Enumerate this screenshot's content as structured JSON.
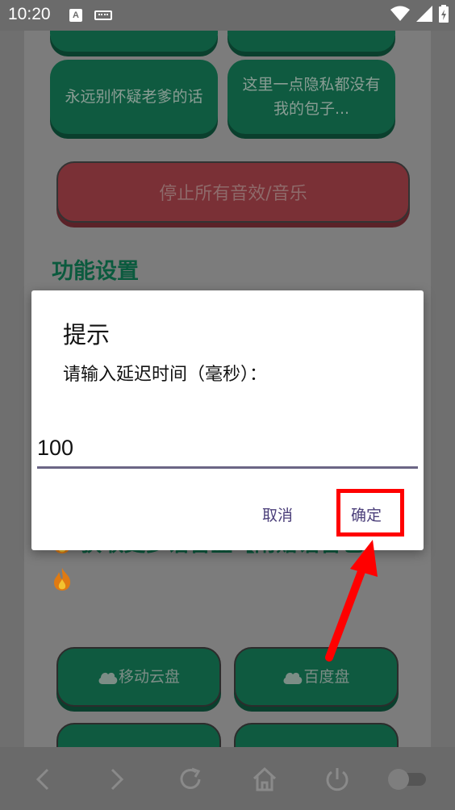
{
  "status_bar": {
    "time": "10:20",
    "a_icon": "A",
    "icons": [
      "wifi-icon",
      "signal-icon",
      "battery-icon"
    ]
  },
  "app": {
    "top_buttons": [
      "",
      ""
    ],
    "buttons_row": [
      {
        "label": "永远别怀疑老爹的话"
      },
      {
        "label": "这里一点隐私都没有我的包子..."
      }
    ],
    "stop_button": "停止所有音效/音乐",
    "section_settings": "功能设置",
    "section_more": "获取更多语音盒【附赠语音包】",
    "cloud_buttons": [
      {
        "label": "移动云盘"
      },
      {
        "label": "百度盘"
      }
    ]
  },
  "dialog": {
    "title": "提示",
    "message": "请输入延迟时间（毫秒）：",
    "input_value": "100",
    "cancel_label": "取消",
    "ok_label": "确定"
  },
  "bottom_bar": {
    "icons": [
      "back-icon",
      "forward-icon",
      "refresh-icon",
      "home-icon",
      "power-icon",
      "toggle-icon"
    ]
  },
  "colors": {
    "accent_green": "#0f5a40",
    "highlight_red": "#ff0000",
    "dialog_button": "#4b3f7a"
  }
}
